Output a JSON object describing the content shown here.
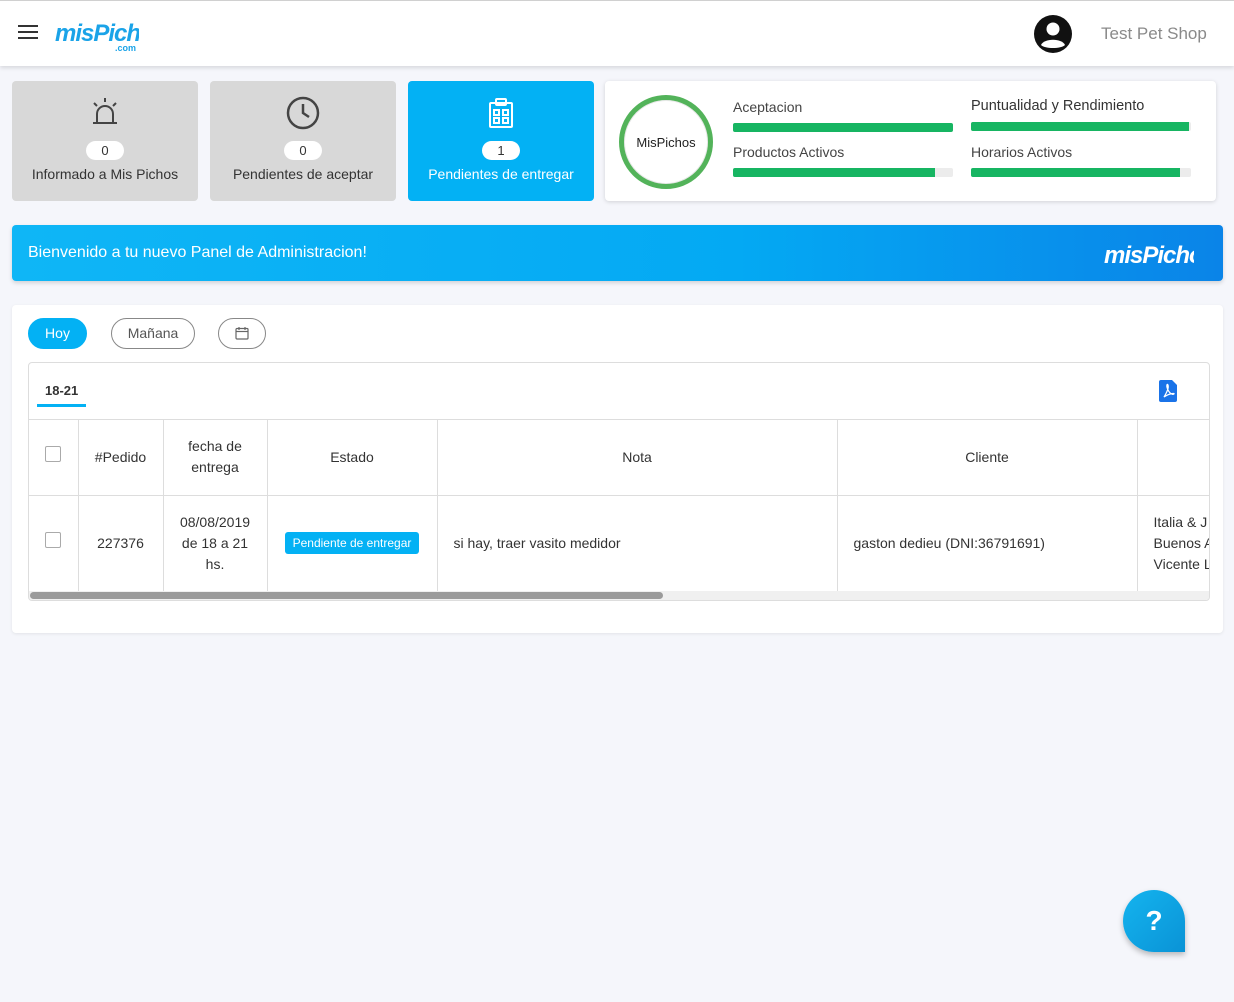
{
  "header": {
    "logo": "misPichos",
    "logo_sub": ".com",
    "shop_name": "Test Pet Shop"
  },
  "stats": [
    {
      "count": "0",
      "label": "Informado a Mis Pichos",
      "icon": "siren-icon"
    },
    {
      "count": "0",
      "label": "Pendientes de aceptar",
      "icon": "clock-icon"
    },
    {
      "count": "1",
      "label": "Pendientes de entregar",
      "icon": "clipboard-icon"
    }
  ],
  "metrics": {
    "ring_label": "MisPichos",
    "ring_color": "#53b35a",
    "items": [
      {
        "label": "Aceptacion",
        "progress": 1.0
      },
      {
        "label": "Puntualidad y Rendimiento",
        "progress": 0.99
      },
      {
        "label": "Productos Activos",
        "progress": 0.92
      },
      {
        "label": "Horarios Activos",
        "progress": 0.95
      }
    ]
  },
  "banner": {
    "text": "Bienvenido a tu nuevo Panel de Administracion!",
    "logo": "misPichos"
  },
  "filters": {
    "today": "Hoy",
    "tomorrow": "Mañana"
  },
  "orders": {
    "tab": "18-21",
    "columns": [
      "#Pedido",
      "fecha de entrega",
      "Estado",
      "Nota",
      "Cliente"
    ],
    "rows": [
      {
        "id": "227376",
        "date": "08/08/2019 de 18 a 21 hs.",
        "status": "Pendiente de entregar",
        "note": "si hay, traer vasito medidor",
        "client": "gaston dedieu (DNI:36791691)",
        "address": "Italia & J Buenos A Vicente L"
      }
    ]
  },
  "help": {
    "label": "?"
  },
  "colors": {
    "accent": "#03b1f4",
    "progress": "#17b562"
  }
}
